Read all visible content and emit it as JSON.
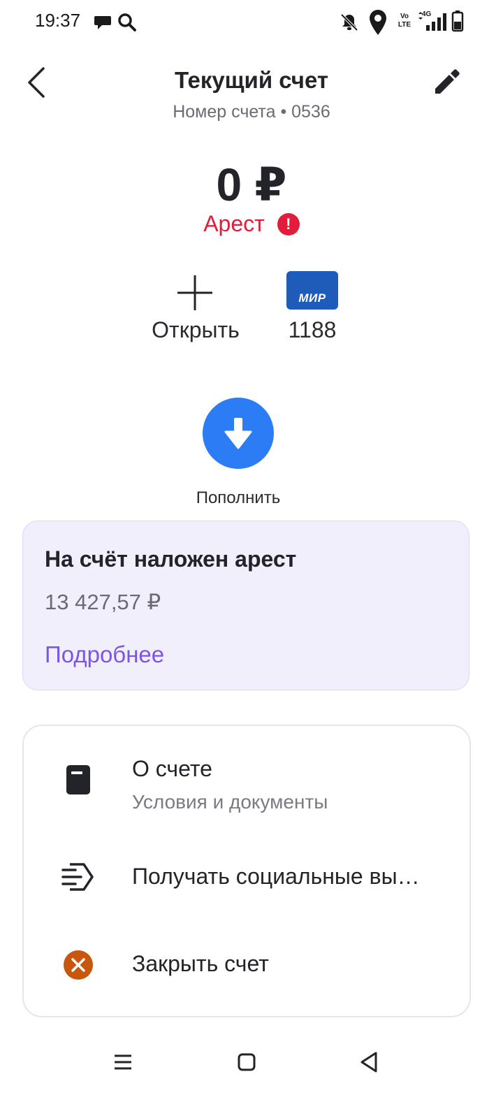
{
  "status_bar": {
    "time": "19:37",
    "icons": [
      "chat-icon",
      "search-icon",
      "mute-icon",
      "location-icon",
      "volte-icon",
      "signal-icon",
      "battery-icon"
    ],
    "volte_top": "Vo",
    "volte_bottom": "LTE",
    "network": "4G"
  },
  "header": {
    "title": "Текущий счет",
    "subtitle": "Номер счета • 0536"
  },
  "balance": {
    "amount": "0 ₽",
    "status": "Арест"
  },
  "actions": {
    "open_label": "Открыть",
    "card_brand": "МИР",
    "card_number": "1188"
  },
  "topup": {
    "label": "Пополнить"
  },
  "alert": {
    "title": "На счёт наложен арест",
    "amount": "13 427,57 ₽",
    "link": "Подробнее"
  },
  "menu": {
    "items": [
      {
        "title": "О счете",
        "subtitle": "Условия и документы"
      },
      {
        "title": "Получать социальные вы…"
      },
      {
        "title": "Закрыть счет"
      }
    ]
  },
  "colors": {
    "arrest_red": "#e01e3c",
    "topup_blue": "#2b7cf5",
    "link_purple": "#7c55e6",
    "mir_blue": "#1f5bb8",
    "close_orange": "#c8560c",
    "alert_bg": "#f2effc"
  }
}
